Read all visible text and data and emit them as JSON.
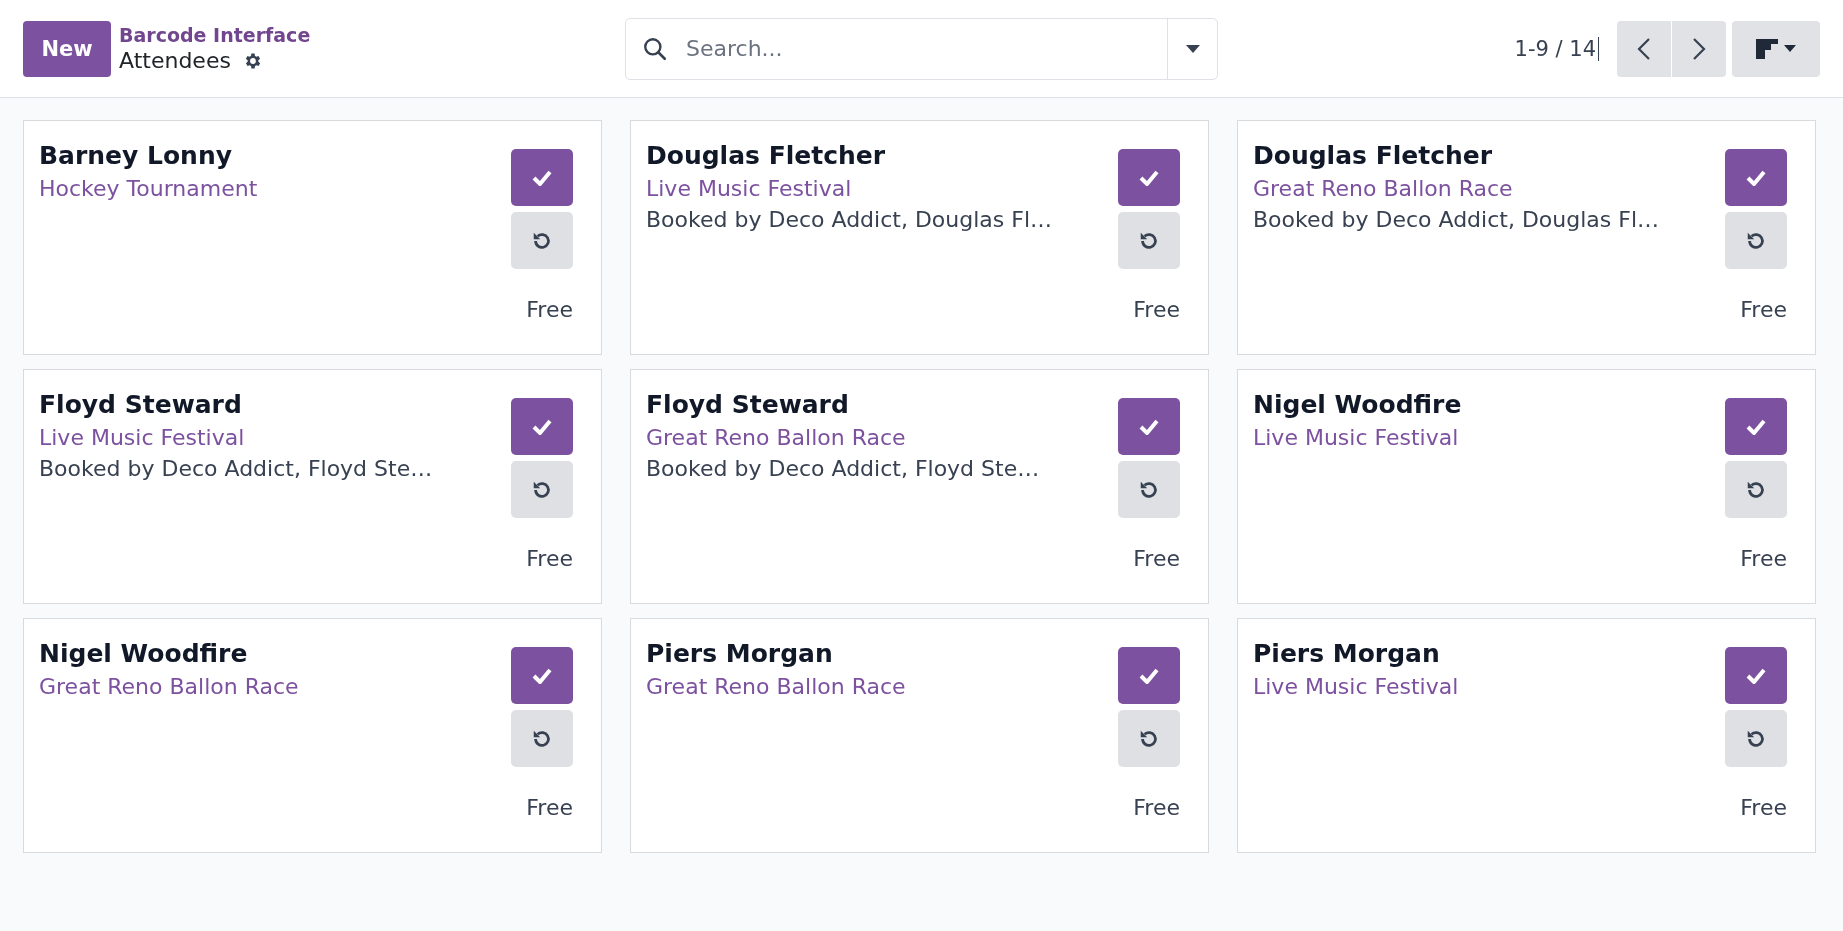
{
  "control_panel": {
    "new_button": "New",
    "breadcrumb": "Barcode Interface",
    "title": "Attendees",
    "search": {
      "placeholder": "Search..."
    },
    "pager": "1-9 / 14"
  },
  "cards": [
    {
      "name": "Barney Lonny",
      "event": "Hockey Tournament",
      "price": "Free"
    },
    {
      "name": "Douglas Fletcher",
      "event": "Live Music Festival",
      "booked_by": "Booked by Deco Addict, Douglas Fl…",
      "price": "Free"
    },
    {
      "name": "Douglas Fletcher",
      "event": "Great Reno Ballon Race",
      "booked_by": "Booked by Deco Addict, Douglas Fl…",
      "price": "Free"
    },
    {
      "name": "Floyd Steward",
      "event": "Live Music Festival",
      "booked_by": "Booked by Deco Addict, Floyd Ste…",
      "price": "Free"
    },
    {
      "name": "Floyd Steward",
      "event": "Great Reno Ballon Race",
      "booked_by": "Booked by Deco Addict, Floyd Ste…",
      "price": "Free"
    },
    {
      "name": "Nigel Woodfire",
      "event": "Live Music Festival",
      "price": "Free"
    },
    {
      "name": "Nigel Woodfire",
      "event": "Great Reno Ballon Race",
      "price": "Free"
    },
    {
      "name": "Piers Morgan",
      "event": "Great Reno Ballon Race",
      "price": "Free"
    },
    {
      "name": "Piers Morgan",
      "event": "Live Music Festival",
      "price": "Free"
    }
  ]
}
